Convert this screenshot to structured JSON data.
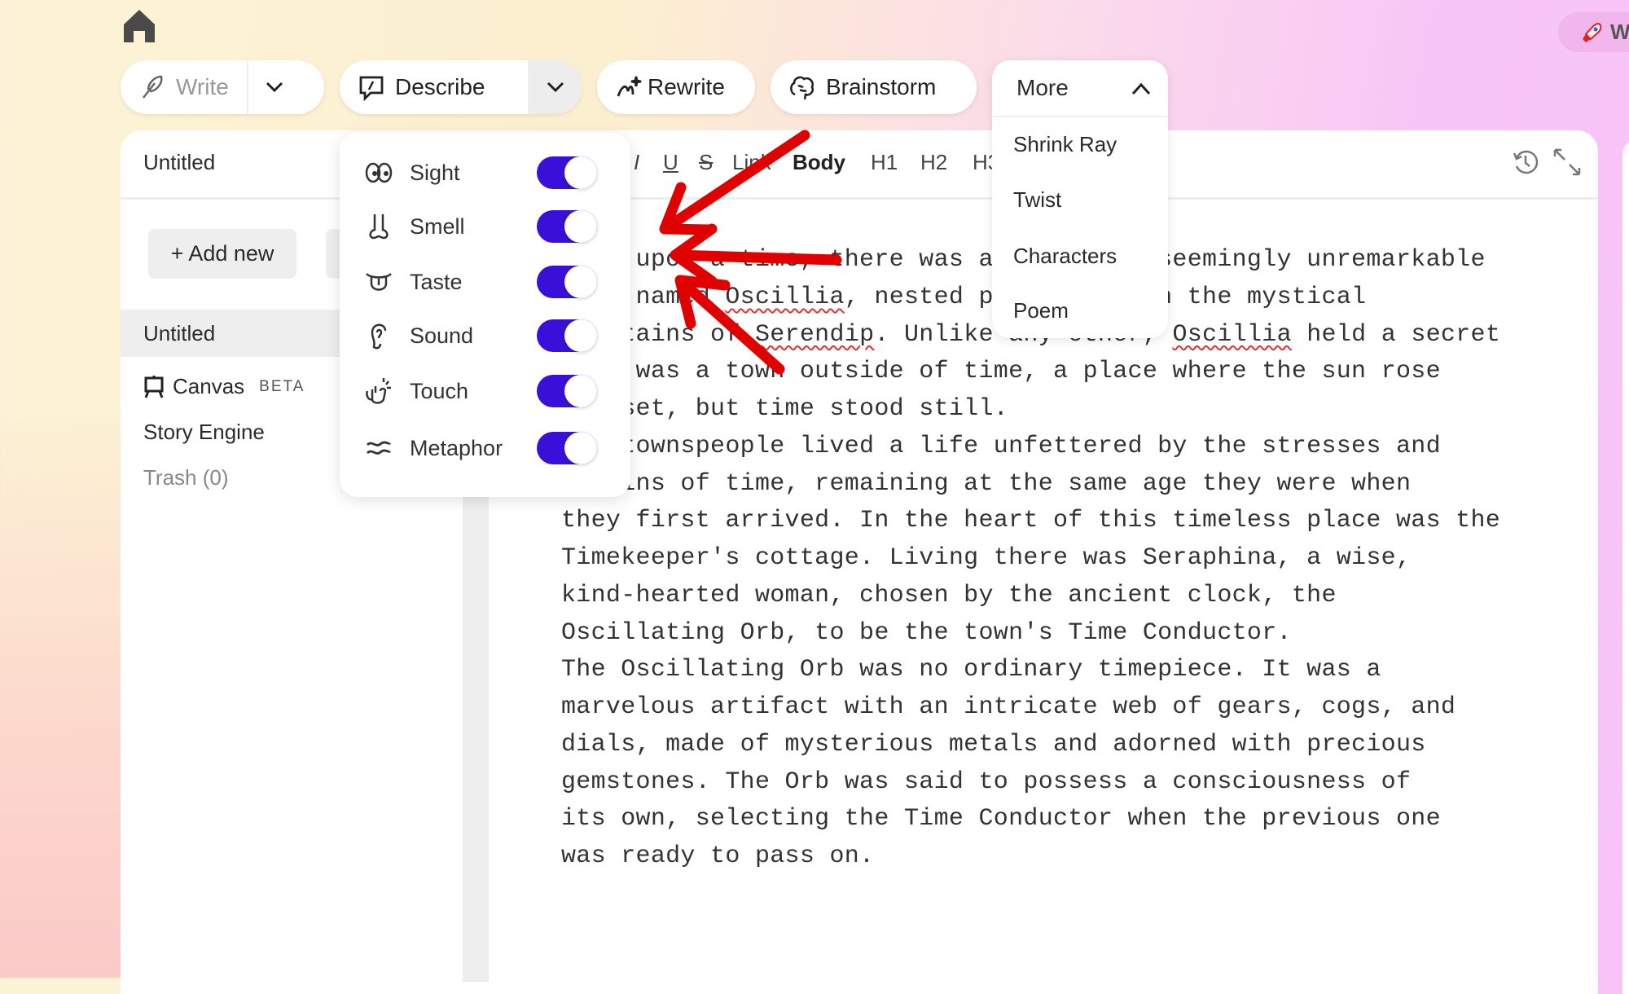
{
  "colors": {
    "accent": "#3a10d8",
    "annotation_arrow": "#e00000",
    "spellcheck": "#e03030"
  },
  "top_right": {
    "icon": "rocket-icon",
    "label": "W"
  },
  "toolbar": {
    "write": {
      "label": "Write",
      "icon": "feather-icon"
    },
    "describe": {
      "label": "Describe",
      "icon": "speech-bubble-icon"
    },
    "rewrite": {
      "label": "Rewrite",
      "icon": "magic-pen-icon"
    },
    "brainstorm": {
      "label": "Brainstorm",
      "icon": "brain-icon"
    },
    "more": {
      "label": "More",
      "expanded": true,
      "items": [
        "Shrink Ray",
        "Twist",
        "Characters",
        "Poem"
      ]
    }
  },
  "describe_menu": {
    "items": [
      {
        "label": "Sight",
        "icon": "eyes-icon",
        "enabled": true
      },
      {
        "label": "Smell",
        "icon": "nose-icon",
        "enabled": true
      },
      {
        "label": "Taste",
        "icon": "tongue-icon",
        "enabled": true
      },
      {
        "label": "Sound",
        "icon": "ear-icon",
        "enabled": true
      },
      {
        "label": "Touch",
        "icon": "hand-icon",
        "enabled": true
      },
      {
        "label": "Metaphor",
        "icon": "approx-icon",
        "enabled": true
      }
    ]
  },
  "document": {
    "title": "Untitled"
  },
  "sidebar": {
    "add_new": "+ Add new",
    "items": [
      {
        "label": "Untitled",
        "selected": true
      },
      {
        "label": "Canvas",
        "badge": "BETA",
        "icon": "canvas-icon"
      },
      {
        "label": "Story Engine"
      },
      {
        "label": "Trash (0)"
      }
    ]
  },
  "format_bar": [
    "I",
    "U",
    "S",
    "Link",
    "Body",
    "H1",
    "H2",
    "H3"
  ],
  "editor": {
    "flagged_words": [
      "Oscillia",
      "Serendip"
    ],
    "lines": [
      "Once upon a time, there was a peaceful, seemingly unremarkable",
      "town named Oscillia, nested peacefully in the mystical",
      "mountains of Serendip. Unlike any other, Oscillia held a secret",
      "- it was a town outside of time, a place where the sun rose",
      "and set, but time stood still.",
      "Its townspeople lived a life unfettered by the stresses and",
      "strains of time, remaining at the same age they were when",
      "they first arrived. In the heart of this timeless place was the",
      "Timekeeper's cottage. Living there was Seraphina, a wise,",
      "kind-hearted woman, chosen by the ancient clock, the",
      "Oscillating Orb, to be the town's Time Conductor.",
      "The Oscillating Orb was no ordinary timepiece. It was a",
      "marvelous artifact with an intricate web of gears, cogs, and",
      "dials, made of mysterious metals and adorned with precious",
      "gemstones. The Orb was said to possess a consciousness of",
      "its own, selecting the Time Conductor when the previous one",
      "was ready to pass on."
    ]
  }
}
